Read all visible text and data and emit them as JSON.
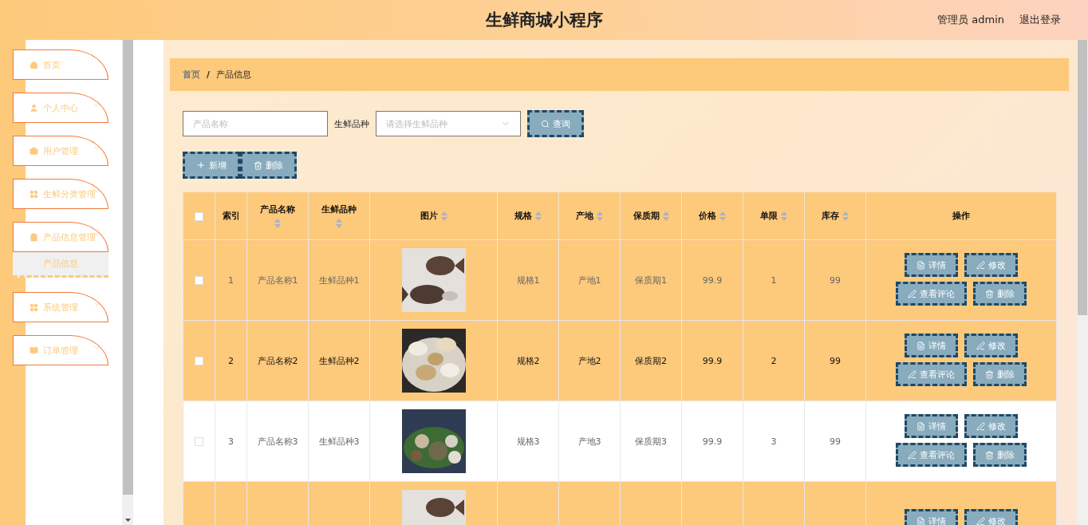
{
  "header": {
    "title": "生鲜商城小程序",
    "user": "管理员 admin",
    "logout": "退出登录"
  },
  "menu": [
    {
      "label": "首页",
      "expandable": false
    },
    {
      "label": "个人中心",
      "expandable": true
    },
    {
      "label": "用户管理",
      "expandable": true
    },
    {
      "label": "生鲜分类管理",
      "expandable": true
    },
    {
      "label": "产品信息管理",
      "expandable": true,
      "children": [
        {
          "label": "产品信息",
          "selected": true
        }
      ]
    },
    {
      "label": "系统管理",
      "expandable": true
    },
    {
      "label": "订单管理",
      "expandable": true
    }
  ],
  "breadcrumb": {
    "separator": "/",
    "items": [
      {
        "label": "首页"
      },
      {
        "label": "产品信息"
      }
    ]
  },
  "search": {
    "name_placeholder": "产品名称",
    "kind_label": "生鲜品种",
    "kind_placeholder": "请选择生鲜品种",
    "query": "查询"
  },
  "actions": {
    "add": "新增",
    "delete": "删除"
  },
  "table": {
    "select_all_checked": false,
    "columns": [
      {
        "label": "索引",
        "sortable": false
      },
      {
        "label": "产品名称",
        "sortable": true,
        "wrap": true
      },
      {
        "label": "生鲜品种",
        "sortable": true,
        "wrap": true
      },
      {
        "label": "图片",
        "sortable": true,
        "wrap": false
      },
      {
        "label": "规格",
        "sortable": true,
        "wrap": false
      },
      {
        "label": "产地",
        "sortable": true,
        "wrap": false
      },
      {
        "label": "保质期",
        "sortable": true,
        "wrap": false
      },
      {
        "label": "价格",
        "sortable": true,
        "wrap": false
      },
      {
        "label": "单限",
        "sortable": true,
        "wrap": false
      },
      {
        "label": "库存",
        "sortable": true,
        "wrap": false
      },
      {
        "label": "操作",
        "sortable": false
      }
    ],
    "rows": [
      {
        "highlighted": true,
        "hovered": false,
        "checked": false,
        "picture": {
          "kind": "picture"
        },
        "cells": [
          "1",
          "产品名称1",
          "生鲜品种1",
          "",
          "规格1",
          "产地1",
          "保质期1",
          "99.9",
          "1",
          "99"
        ],
        "buttons": [
          "详情",
          "修改",
          "查看评论",
          "删除"
        ]
      },
      {
        "highlighted": true,
        "hovered": true,
        "checked": false,
        "picture": {
          "kind": "picture"
        },
        "cells": [
          "2",
          "产品名称2",
          "生鲜品种2",
          "",
          "规格2",
          "产地2",
          "保质期2",
          "99.9",
          "2",
          "99"
        ],
        "buttons": [
          "详情",
          "修改",
          "查看评论",
          "删除"
        ]
      },
      {
        "highlighted": false,
        "hovered": false,
        "checked": false,
        "picture": {
          "kind": "picture"
        },
        "cells": [
          "3",
          "产品名称3",
          "生鲜品种3",
          "",
          "规格3",
          "产地3",
          "保质期3",
          "99.9",
          "3",
          "99"
        ],
        "buttons": [
          "详情",
          "修改",
          "查看评论",
          "删除"
        ]
      },
      {
        "highlighted": true,
        "hovered": false,
        "picture": {
          "kind": "picture"
        },
        "buttons": [
          "详情",
          "修改"
        ]
      }
    ]
  }
}
